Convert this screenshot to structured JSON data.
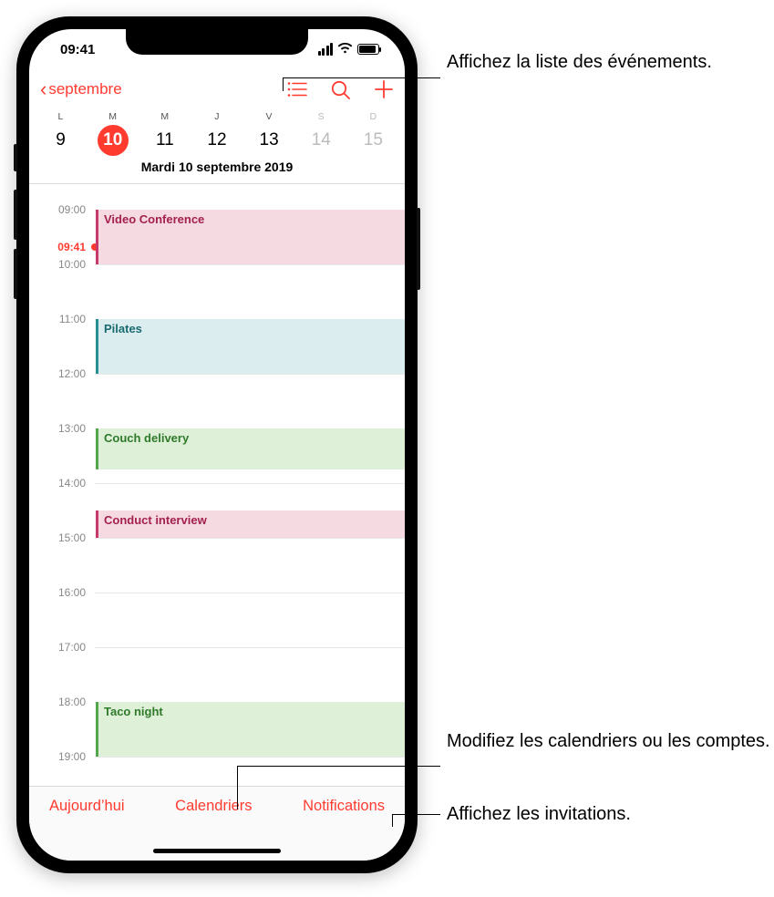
{
  "status": {
    "time": "09:41"
  },
  "nav": {
    "back_label": "septembre"
  },
  "week": {
    "labels": [
      "L",
      "M",
      "M",
      "J",
      "V",
      "S",
      "D"
    ],
    "nums": [
      "9",
      "10",
      "11",
      "12",
      "13",
      "14",
      "15"
    ],
    "selected_index": 1
  },
  "date_title": "Mardi  10 septembre 2019",
  "hours": [
    "09:00",
    "10:00",
    "11:00",
    "12:00",
    "13:00",
    "14:00",
    "15:00",
    "16:00",
    "17:00",
    "18:00",
    "19:00"
  ],
  "now_label": "09:41",
  "events": [
    {
      "title": "Video Conference",
      "start_hour": 9.0,
      "end_hour": 10.0,
      "color": "pink"
    },
    {
      "title": "Pilates",
      "start_hour": 11.0,
      "end_hour": 12.0,
      "color": "teal"
    },
    {
      "title": "Couch delivery",
      "start_hour": 13.0,
      "end_hour": 13.75,
      "color": "green"
    },
    {
      "title": "Conduct interview",
      "start_hour": 14.5,
      "end_hour": 15.0,
      "color": "pink"
    },
    {
      "title": "Taco night",
      "start_hour": 18.0,
      "end_hour": 19.0,
      "color": "green"
    }
  ],
  "toolbar": {
    "today": "Aujourd’hui",
    "calendars": "Calendriers",
    "inbox": "Notifications"
  },
  "callouts": {
    "list": "Affichez la liste des événements.",
    "calendars": "Modifiez les calendriers ou les comptes.",
    "inbox": "Affichez les invitations."
  }
}
